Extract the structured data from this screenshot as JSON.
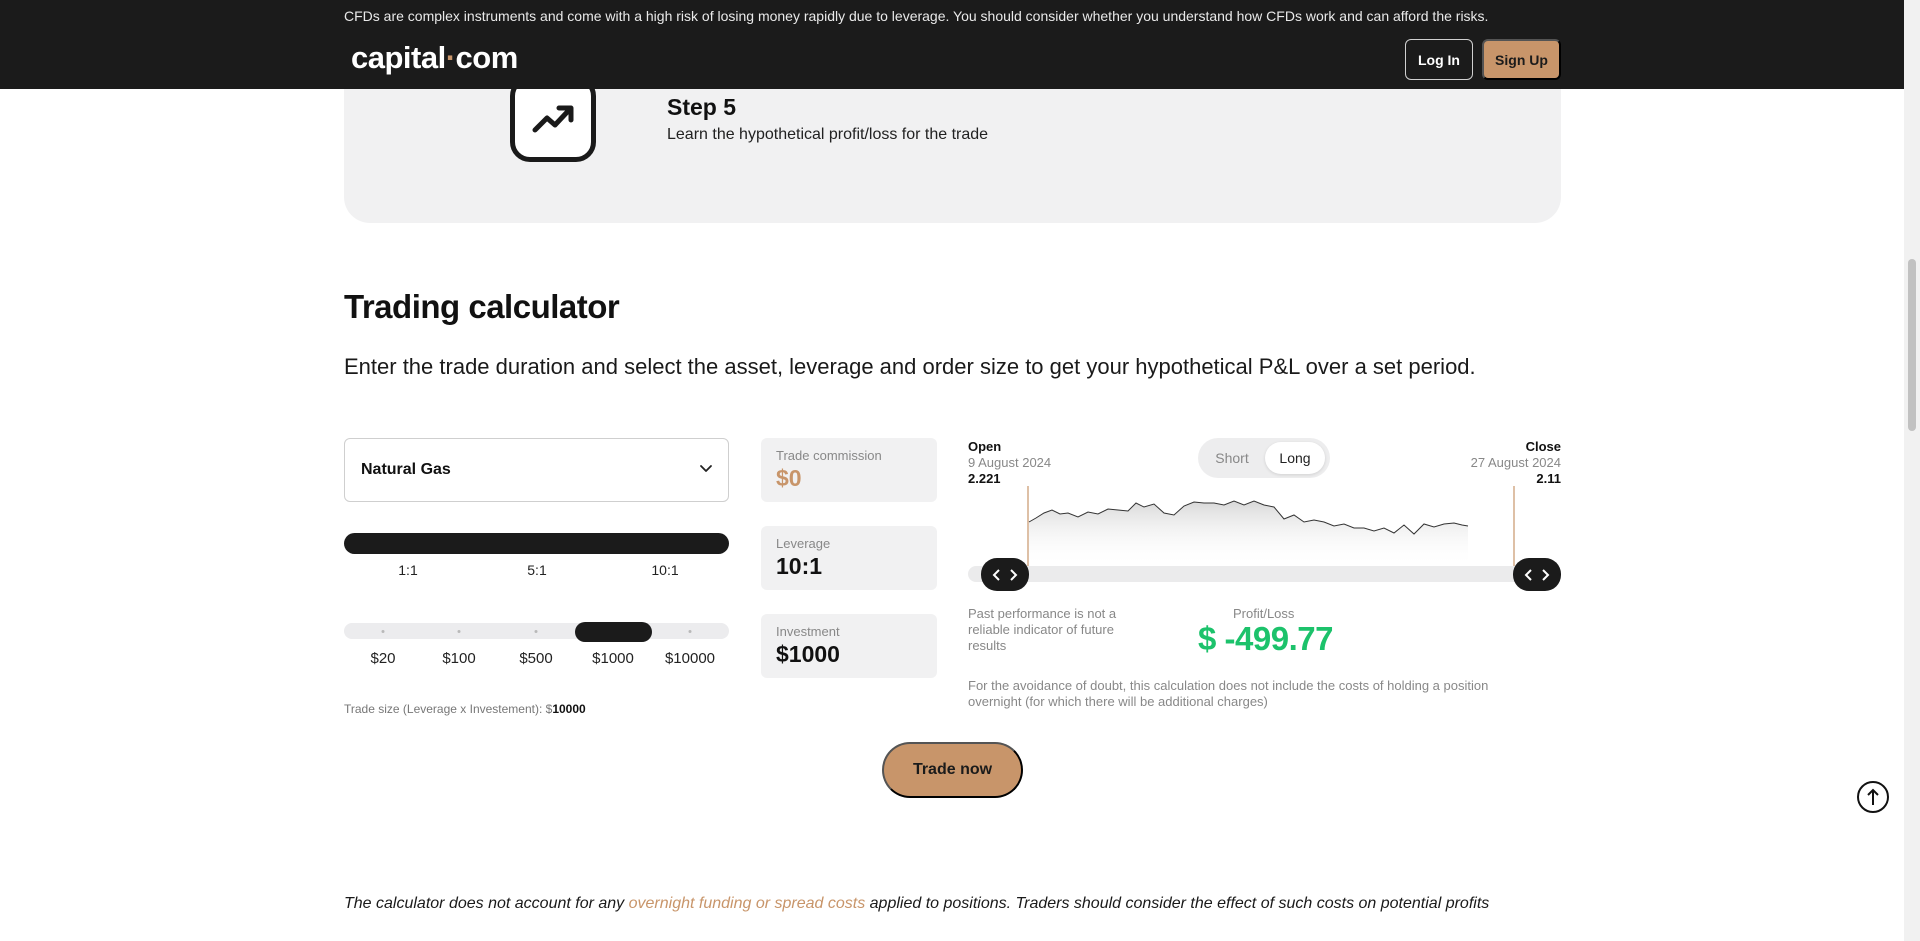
{
  "header": {
    "risk_warning": "CFDs are complex instruments and come with a high risk of losing money rapidly due to leverage. You should consider whether you understand how CFDs work and can afford the risks.",
    "logo_left": "capital",
    "logo_dot": "·",
    "logo_right": "com",
    "login_label": "Log In",
    "signup_label": "Sign Up"
  },
  "step": {
    "title": "Step 5",
    "description": "Learn the hypothetical profit/loss for the trade",
    "icon": "trending-up-icon"
  },
  "calculator": {
    "title": "Trading calculator",
    "description": "Enter the trade duration and select the asset, leverage and order size to get your hypothetical P&L over a set period.",
    "asset": "Natural Gas",
    "leverage_options": [
      "1:1",
      "5:1",
      "10:1"
    ],
    "leverage_selected": "10:1",
    "investment_options": [
      "$20",
      "$100",
      "$500",
      "$1000",
      "$10000"
    ],
    "investment_selected": "$1000",
    "trade_size_label": "Trade size (Leverage x Investement): $",
    "trade_size_value": "10000",
    "commission_label": "Trade commission",
    "commission_value": "$0",
    "leverage_label": "Leverage",
    "leverage_value": "10:1",
    "investment_label": "Investment",
    "investment_value": "$1000",
    "direction_options": [
      "Short",
      "Long"
    ],
    "direction_selected": "Long",
    "open": {
      "label": "Open",
      "date": "9 August 2024",
      "price": "2.221"
    },
    "close": {
      "label": "Close",
      "date": "27 August 2024",
      "price": "2.11"
    },
    "past_performance_note": "Past performance is not a reliable indicator of future results",
    "pl_label": "Profit/Loss",
    "pl_value": "$ -499.77",
    "avoid_doubt_note": "For the avoidance of doubt, this calculation does not include the costs of holding a position overnight (for which there will be additional charges)",
    "trade_now_label": "Trade now"
  },
  "disclaimer": {
    "before": "The calculator does not account for any ",
    "link": "overnight funding or spread costs",
    "after": " applied to positions. Traders should consider the effect of such costs on potential profits"
  },
  "colors": {
    "accent": "#c8956a",
    "dark": "#1b1b1b",
    "profit_loss": "#1cc26b"
  }
}
